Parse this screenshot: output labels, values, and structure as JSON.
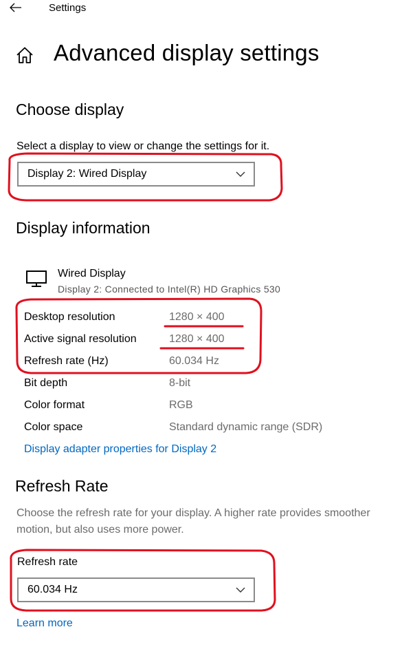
{
  "header": {
    "back_icon": "back-arrow-icon",
    "window_title": "Settings"
  },
  "page": {
    "home_icon": "home-icon",
    "title": "Advanced display settings"
  },
  "choose_display": {
    "title": "Choose display",
    "instruction": "Select a display to view or change the settings for it.",
    "selected": "Display 2: Wired Display"
  },
  "display_info": {
    "title": "Display information",
    "monitor_icon": "monitor-icon",
    "name": "Wired Display",
    "connection": "Display 2: Connected to Intel(R) HD Graphics 530",
    "rows": [
      {
        "label": "Desktop resolution",
        "value": "1280 × 400"
      },
      {
        "label": "Active signal resolution",
        "value": "1280 × 400"
      },
      {
        "label": "Refresh rate (Hz)",
        "value": "60.034 Hz"
      },
      {
        "label": "Bit depth",
        "value": "8-bit"
      },
      {
        "label": "Color format",
        "value": "RGB"
      },
      {
        "label": "Color space",
        "value": "Standard dynamic range (SDR)"
      }
    ],
    "adapter_link": "Display adapter properties for Display 2"
  },
  "refresh_rate": {
    "title": "Refresh Rate",
    "description": "Choose the refresh rate for your display. A higher rate provides smoother motion, but also uses more power.",
    "field_label": "Refresh rate",
    "selected": "60.034 Hz",
    "learn_more": "Learn more"
  },
  "colors": {
    "link": "#0067c0",
    "annotation": "#e0101e",
    "secondary_text": "#6b6b6b"
  }
}
